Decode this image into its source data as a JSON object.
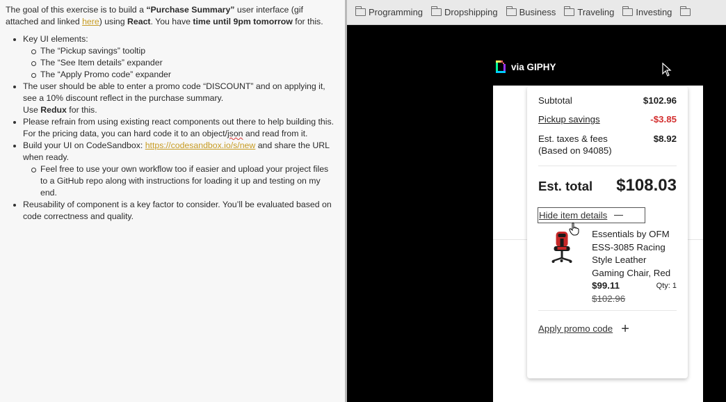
{
  "doc": {
    "intro": {
      "p1": "The goal of this exercise is to build a ",
      "b1": "“Purchase Summary”",
      "p2": " user interface (gif attached and linked ",
      "link": "here",
      "p3": ") using ",
      "b2": "React",
      "p4": ". You have ",
      "b3": "time until 9pm tomorrow",
      "p5": " for this."
    },
    "bullet1": {
      "text": "Key UI elements:",
      "sub": [
        "The “Pickup savings” tooltip",
        "The “See Item details” expander",
        "The “Apply Promo code” expander"
      ]
    },
    "bullet2": {
      "text": "The user should be able to enter a promo code “DISCOUNT” and on applying it, see a 10% discount reflect in the purchase summary.",
      "use": "Use ",
      "redux": "Redux",
      "for_this": " for this."
    },
    "bullet3": {
      "text": "Please refrain from using existing react components out there to help building this. For the pricing data, you can hard code it to an object/",
      "squiggle": "json",
      "end": " and read from it."
    },
    "bullet4": {
      "pre": "Build your UI on CodeSandbox: ",
      "link": "https://codesandbox.io/s/new",
      "post": " and share the URL when ready.",
      "sub": "Feel free to use your own workflow too if easier and upload your project files to a GitHub repo along with instructions for loading it up and testing on my end."
    },
    "bullet5": "Reusability of component is a key factor to consider. You’ll be evaluated based on code correctness and quality."
  },
  "bookmarks": [
    "Programming",
    "Dropshipping",
    "Business",
    "Traveling",
    "Investing"
  ],
  "giphy_label": "via GIPHY",
  "summary": {
    "subtotal_label": "Subtotal",
    "subtotal_value": "$102.96",
    "pickup_label": "Pickup savings",
    "pickup_value": "-$3.85",
    "tax_label_1": "Est. taxes & fees",
    "tax_label_2": "(Based on 94085)",
    "tax_value": "$8.92",
    "total_label": "Est. total",
    "total_value": "$108.03",
    "hide_details_label": "Hide item details",
    "item": {
      "name": "Essentials by OFM ESS-3085 Racing Style Leather Gaming Chair, Red",
      "price": "$99.11",
      "qty": "Qty: 1",
      "original_price": "$102.96"
    },
    "promo_label": "Apply promo code"
  },
  "colors": {
    "link": "#c79b22",
    "savings": "#d32f2f",
    "browser_bg": "#000000"
  },
  "icons": [
    "folder-icon",
    "giphy-logo-icon",
    "mouse-cursor-icon",
    "hand-cursor-icon",
    "chair-image",
    "minus-icon",
    "plus-icon"
  ]
}
